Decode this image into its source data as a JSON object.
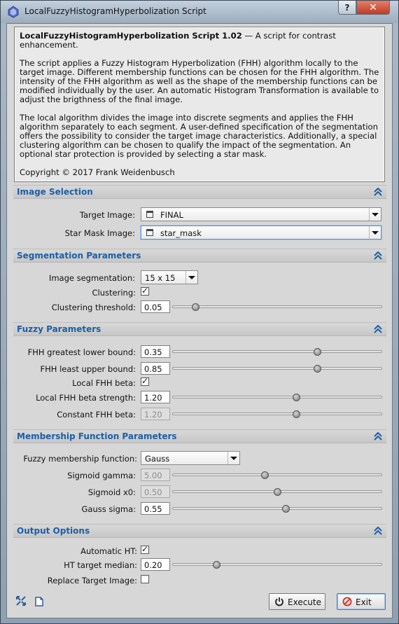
{
  "window": {
    "title": "LocalFuzzyHistogramHyperbolization Script",
    "help_label": "?",
    "close_label": "✕"
  },
  "info": {
    "heading": "LocalFuzzyHistogramHyperbolization Script 1.02",
    "heading_suffix": " — A script for contrast enhancement.",
    "para1": "The script applies a Fuzzy Histogram Hyperbolization (FHH) algorithm locally to the target image. Different membership functions can be chosen for the FHH algorithm. The intensity of the FHH algorithm as well as the shape of the membership functions can be modified individually by the user. An automatic Histogram Transformation is available to adjust the brigthness of the final image.",
    "para2": "The local algorithm divides the image into discrete segments and applies the FHH algorithm separately to each segment. A user-defined specification of the segmentation offers the possibility to consider the target image characteristics. Additionally, a special clustering algorithm can be chosen to qualify the impact of the segmentation. An optional star protection is provided by selecting a star mask.",
    "copyright": "Copyright © 2017 Frank Weidenbusch"
  },
  "image_selection": {
    "header": "Image Selection",
    "target_label": "Target Image:",
    "target_value": "FINAL",
    "starmask_label": "Star Mask Image:",
    "starmask_value": "star_mask"
  },
  "segmentation": {
    "header": "Segmentation Parameters",
    "segmentation_label": "Image segmentation:",
    "segmentation_value": "15 x 15",
    "clustering_label": "Clustering:",
    "clustering_checked": true,
    "threshold_label": "Clustering threshold:",
    "threshold_value": "0.05",
    "threshold_level": 0.11
  },
  "fuzzy": {
    "header": "Fuzzy Parameters",
    "lower_label": "FHH greatest lower bound:",
    "lower_value": "0.35",
    "lower_level": 0.69,
    "upper_label": "FHH least upper bound:",
    "upper_value": "0.85",
    "upper_level": 0.69,
    "local_beta_label": "Local FHH beta:",
    "local_beta_checked": true,
    "beta_strength_label": "Local FHH beta strength:",
    "beta_strength_value": "1.20",
    "beta_strength_level": 0.59,
    "constant_beta_label": "Constant FHH beta:",
    "constant_beta_value": "1.20",
    "constant_beta_level": 0.59
  },
  "membership": {
    "header": "Membership Function Parameters",
    "function_label": "Fuzzy membership function:",
    "function_value": "Gauss",
    "sig_gamma_label": "Sigmoid gamma:",
    "sig_gamma_value": "5.00",
    "sig_gamma_level": 0.44,
    "sig_x0_label": "Sigmoid x0:",
    "sig_x0_value": "0.50",
    "sig_x0_level": 0.5,
    "gauss_sigma_label": "Gauss sigma:",
    "gauss_sigma_value": "0.55",
    "gauss_sigma_level": 0.54
  },
  "output": {
    "header": "Output Options",
    "auto_ht_label": "Automatic HT:",
    "auto_ht_checked": true,
    "ht_median_label": "HT target median:",
    "ht_median_value": "0.20",
    "ht_median_level": 0.21,
    "replace_label": "Replace Target Image:",
    "replace_checked": false
  },
  "footer": {
    "execute_label": "Execute",
    "exit_label": "Exit"
  },
  "colors": {
    "section_text": "#1b5fa8",
    "exit_icon": "#d13b2b"
  },
  "icons": {
    "collapse": "double-chevron-up-icon",
    "new_instance": "new-instance-icon",
    "documentation": "document-icon",
    "execute": "power-icon",
    "exit": "cancel-circle-icon"
  }
}
